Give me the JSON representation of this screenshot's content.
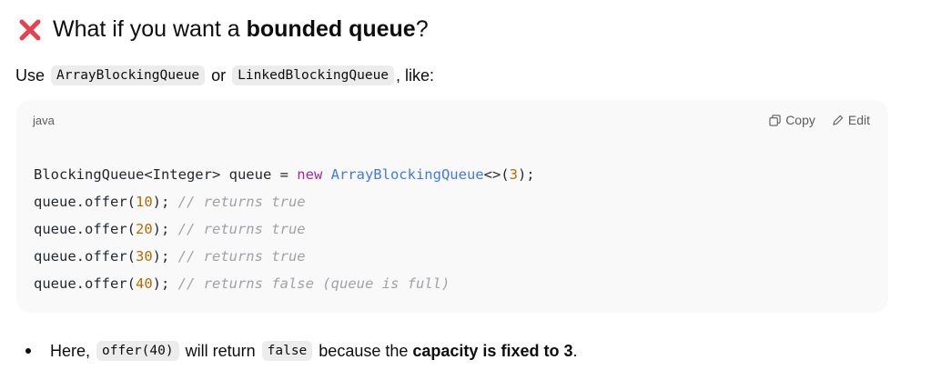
{
  "heading": {
    "prefix": "What if you want a ",
    "bold": "bounded queue",
    "suffix": "?"
  },
  "intro": {
    "text1": "Use ",
    "code1": "ArrayBlockingQueue",
    "text2": " or ",
    "code2": "LinkedBlockingQueue",
    "text3": ", like:"
  },
  "codeblock": {
    "language": "java",
    "copy_label": "Copy",
    "edit_label": "Edit",
    "line1": {
      "a": "BlockingQueue<Integer> queue = ",
      "kw": "new",
      "sp": " ",
      "type": "ArrayBlockingQueue",
      "b": "<>(",
      "num": "3",
      "c": ");"
    },
    "line2": {
      "a": "queue.offer(",
      "num": "10",
      "b": "); ",
      "comment": "// returns true"
    },
    "line3": {
      "a": "queue.offer(",
      "num": "20",
      "b": "); ",
      "comment": "// returns true"
    },
    "line4": {
      "a": "queue.offer(",
      "num": "30",
      "b": "); ",
      "comment": "// returns true"
    },
    "line5": {
      "a": "queue.offer(",
      "num": "40",
      "b": "); ",
      "comment": "// returns false (queue is full)"
    }
  },
  "bullet": {
    "text1": "Here, ",
    "code1": "offer(40)",
    "text2": " will return ",
    "code2": "false",
    "text3": " because the ",
    "bold": "capacity is fixed to 3",
    "text4": "."
  },
  "icons": {
    "heading": "cross-mark-icon",
    "copy": "copy-icon",
    "edit": "pencil-icon"
  },
  "colors": {
    "cross": "#e8414d",
    "keyword": "#a626a4",
    "type": "#4078f2",
    "number": "#b76b01",
    "comment": "#a0a1a7"
  }
}
